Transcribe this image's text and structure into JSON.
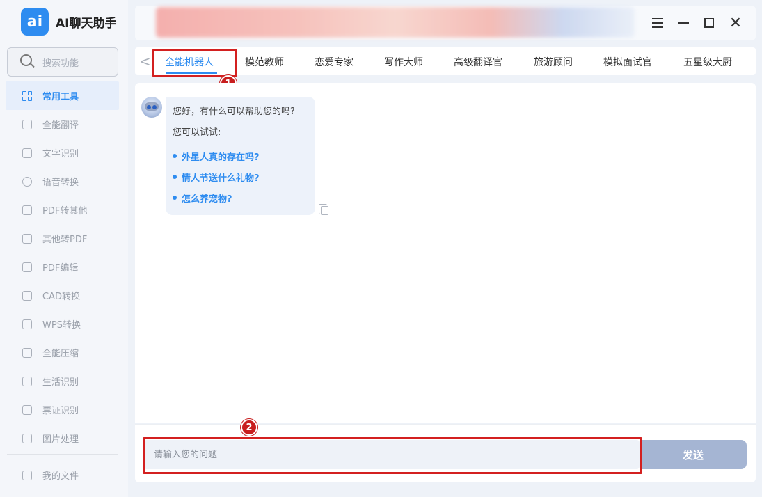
{
  "app": {
    "logo_mark": "ai",
    "title": "AI聊天助手"
  },
  "search": {
    "placeholder": "搜索功能"
  },
  "sidebar": {
    "items": [
      {
        "label": "常用工具",
        "active": true
      },
      {
        "label": "全能翻译"
      },
      {
        "label": "文字识别"
      },
      {
        "label": "语音转换"
      },
      {
        "label": "PDF转其他"
      },
      {
        "label": "其他转PDF"
      },
      {
        "label": "PDF编辑"
      },
      {
        "label": "CAD转换"
      },
      {
        "label": "WPS转换"
      },
      {
        "label": "全能压缩"
      },
      {
        "label": "生活识别"
      },
      {
        "label": "票证识别"
      },
      {
        "label": "图片处理"
      }
    ],
    "my_files": "我的文件"
  },
  "window_controls": {
    "menu": "menu-icon",
    "minimize": "minimize-icon",
    "maximize": "maximize-icon",
    "close": "✕"
  },
  "tabs": [
    {
      "label": "全能机器人",
      "active": true
    },
    {
      "label": "模范教师"
    },
    {
      "label": "恋爱专家"
    },
    {
      "label": "写作大师"
    },
    {
      "label": "高级翻译官"
    },
    {
      "label": "旅游顾问"
    },
    {
      "label": "模拟面试官"
    },
    {
      "label": "五星级大厨"
    }
  ],
  "tab_prev": "<",
  "chat": {
    "greeting": "您好，有什么可以帮助您的吗?",
    "hint": "您可以试试:",
    "suggestions": [
      "外星人真的存在吗?",
      "情人节送什么礼物?",
      "怎么养宠物?"
    ]
  },
  "input": {
    "placeholder": "请输入您的问题",
    "send_label": "发送"
  },
  "annotations": [
    "1",
    "2"
  ],
  "colors": {
    "accent": "#2e8cf0",
    "annotation": "#d32020",
    "send_disabled": "#a5b5d3"
  }
}
